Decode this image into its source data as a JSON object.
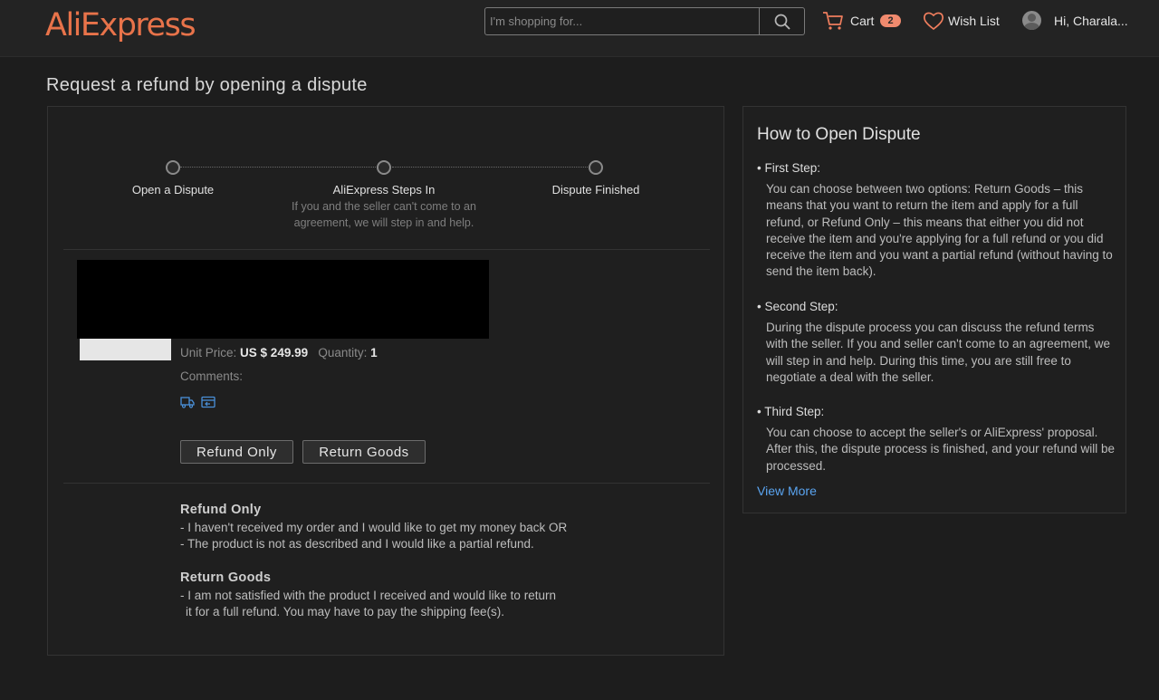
{
  "header": {
    "logo": "AliExpress",
    "logo_tm": "™",
    "search_placeholder": "I'm shopping for...",
    "cart_label": "Cart",
    "cart_count": "2",
    "wishlist_label": "Wish List",
    "user_greeting": "Hi, Charala..."
  },
  "page_title": "Request a refund by opening a dispute",
  "steps": [
    {
      "label": "Open a Dispute"
    },
    {
      "label": "AliExpress Steps In",
      "sub": "If you and the seller can't come to an agreement, we will step in and help."
    },
    {
      "label": "Dispute Finished"
    }
  ],
  "item": {
    "unit_price_label": "Unit Price:",
    "unit_price": "US $ 249.99",
    "quantity_label": "Quantity:",
    "quantity": "1",
    "comments_label": "Comments:"
  },
  "buttons": {
    "refund_only": "Refund Only",
    "return_goods": "Return Goods"
  },
  "info": {
    "refund_title": "Refund Only",
    "refund_line1": "- I haven't received my order and I would like to get my money back OR",
    "refund_line2": "- The product is not as described and I would like a partial refund.",
    "return_title": "Return Goods",
    "return_line1": "- I am not satisfied with the product I received and would like to return",
    "return_line2": "it for a full refund. You may have to pay the shipping fee(s)."
  },
  "side": {
    "title": "How to Open Dispute",
    "step1_title": "• First Step:",
    "step1_desc": "You can choose between two options: Return Goods – this means that you want to return the item and apply for a full refund, or Refund Only – this means that either you did not receive the item and you're applying for a full refund or you did receive the item and you want a partial refund (without having to send the item back).",
    "step2_title": "• Second Step:",
    "step2_desc": "During the dispute process you can discuss the refund terms with the seller. If you and seller can't come to an agreement, we will step in and help. During this time, you are still free to negotiate a deal with the seller.",
    "step3_title": "• Third Step:",
    "step3_desc": "You can choose to accept the seller's or AliExpress' proposal. After this, the dispute process is finished, and your refund will be processed.",
    "view_more": "View More"
  },
  "colors": {
    "brand": "#e8734a",
    "badge": "#f08a6e",
    "link": "#5aa4f0",
    "mini_icon": "#4a90d9"
  }
}
